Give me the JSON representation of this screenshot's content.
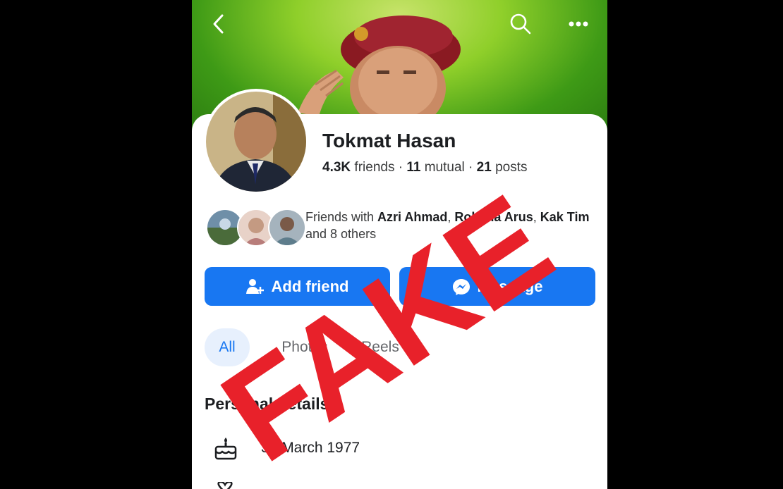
{
  "topbar": {
    "back_icon": "chevron-left-icon",
    "search_icon": "search-icon",
    "more_icon": "more-horizontal-icon"
  },
  "profile": {
    "name": "Tokmat Hasan",
    "friends_count": "4.3K",
    "friends_label": "friends",
    "mutual_count": "11",
    "mutual_label": "mutual",
    "posts_count": "21",
    "posts_label": "posts",
    "separator": "·"
  },
  "mutual_friends": {
    "prefix": "Friends with",
    "names": [
      "Azri Ahmad",
      "Rohana Arus",
      "Kak Tim"
    ],
    "suffix": "and 8 others"
  },
  "actions": {
    "add_friend_label": "Add friend",
    "message_label": "Message"
  },
  "tabs": [
    {
      "label": "All",
      "active": true
    },
    {
      "label": "Photos",
      "active": false
    },
    {
      "label": "Reels",
      "active": false
    }
  ],
  "details": {
    "title": "Personal details",
    "birthday": "30 March 1977",
    "birthday_icon": "cake-icon"
  },
  "overlay": {
    "stamp_text": "FAKE",
    "stamp_color": "#e8212a"
  },
  "colors": {
    "accent": "#1877f2",
    "tab_active_bg": "#e7f0fd"
  }
}
